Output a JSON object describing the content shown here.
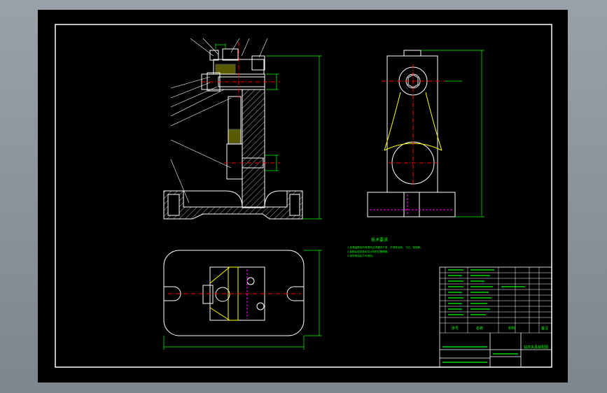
{
  "colors": {
    "background": "#000000",
    "frame": "#ffffff",
    "dimension": "#00ff00",
    "centerline": "#ff0000",
    "hidden": "#ff00ff",
    "highlight": "#ffff00",
    "hatch": "#ffffff"
  },
  "notes": {
    "title": "技术要求",
    "lines": [
      "1.夹具装配前所有零件必须清洗干净，不得有毛刺、飞边、锈蚀等。",
      "2.装配后检查各定位元件的位置精度。",
      "3.涂防锈油后方可使用。"
    ]
  },
  "title_block": {
    "drawing_name": "钻床夹具装配图",
    "header": [
      "序号",
      "名称",
      "材料",
      "备注"
    ]
  }
}
